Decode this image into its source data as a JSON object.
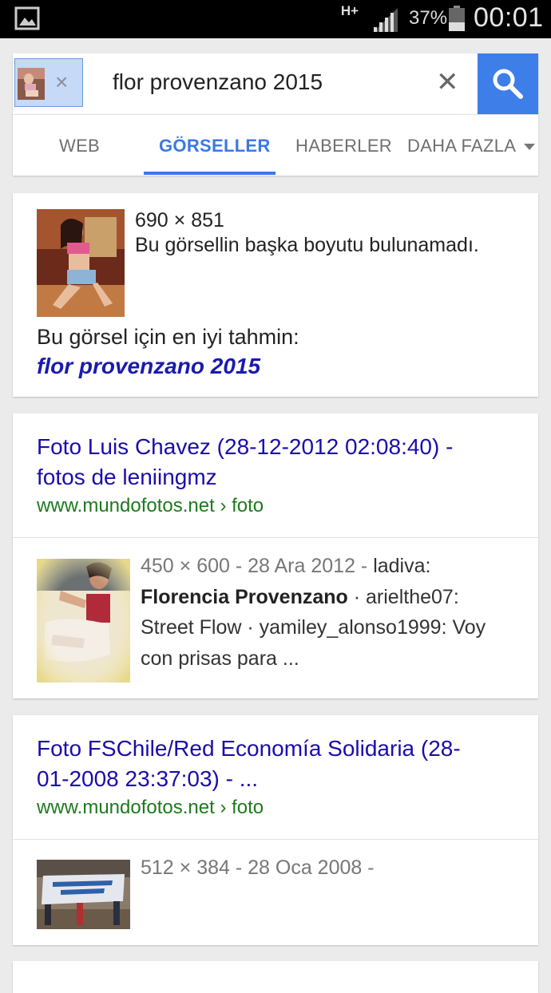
{
  "status_bar": {
    "network": "H+",
    "battery_pct": "37%",
    "time": "00:01",
    "icons": [
      "gallery-icon",
      "signal-icon",
      "battery-icon"
    ]
  },
  "search": {
    "query": "flor provenzano 2015",
    "chip_close": "×",
    "clear": "✕",
    "button_icon": "search-icon"
  },
  "tabs": [
    {
      "label": "WEB",
      "active": false
    },
    {
      "label": "GÖRSELLER",
      "active": true
    },
    {
      "label": "HABERLER",
      "active": false
    },
    {
      "label": "DAHA FAZLA",
      "active": false
    }
  ],
  "best_guess_card": {
    "dimensions": "690 × 851",
    "no_other_sizes": "Bu görsellin başka boyutu bulunamadı.",
    "best_guess_label": "Bu görsel için en iyi tahmin:",
    "best_guess_link": "flor provenzano 2015"
  },
  "results": [
    {
      "title_line1": "Foto Luis Chavez (28-12-2012 02:08:40) -",
      "title_line2": "fotos de leniingmz",
      "url": "www.mundofotos.net › foto",
      "meta_size_date": "450 × 600 - 28 Ara 2012 -",
      "meta_rest1": " ladiva:",
      "meta_bold": "Florencia Provenzano",
      "meta_rest2": " · arielthe07:",
      "meta_line3": "Street Flow · yamiley_alonso1999: Voy",
      "meta_line4": "con prisas para ..."
    },
    {
      "title_line1": "Foto FSChile/Red Economía Solidaria (28-",
      "title_line2": "01-2008 23:37:03) - ...",
      "url": "www.mundofotos.net › foto",
      "meta_size_date": "512 × 384 - 28 Oca 2008 -"
    }
  ],
  "colors": {
    "accent_blue": "#3b78e7",
    "link_blue": "#1a0dab",
    "url_green": "#1d7a1d",
    "search_button": "#3d7ee8"
  }
}
